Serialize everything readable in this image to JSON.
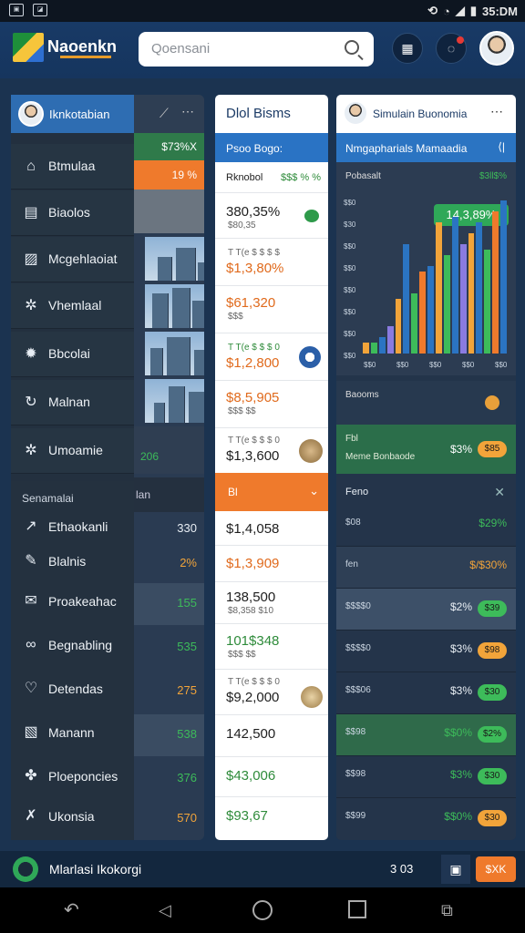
{
  "status": {
    "time": "35:DM",
    "icons": [
      "image-icon",
      "screenshot-icon",
      "sync-icon",
      "wifi-icon",
      "signal-icon",
      "battery-icon"
    ]
  },
  "header": {
    "brand": "Naoenkn",
    "search_placeholder": "Qoensani"
  },
  "drawer": {
    "title": "Iknkotabian",
    "items": [
      {
        "label": "Btmulaa",
        "icon": "home-icon"
      },
      {
        "label": "Biaolos",
        "icon": "document-icon"
      },
      {
        "label": "Mcgehlaoiat",
        "icon": "image-icon"
      },
      {
        "label": "Vhemlaal",
        "icon": "settings-icon"
      },
      {
        "label": "Bbcolai",
        "icon": "gear-icon"
      },
      {
        "label": "Malnan",
        "icon": "refresh-icon"
      },
      {
        "label": "Umoamie",
        "icon": "settings-icon"
      }
    ],
    "section": "Senamalai",
    "items2": [
      {
        "label": "Ethaokanli",
        "icon": "trend-icon"
      },
      {
        "label": "Blalnis",
        "icon": "edit-icon"
      },
      {
        "label": "Proakeahac",
        "icon": "mail-icon"
      },
      {
        "label": "Begnabling",
        "icon": "link-icon"
      },
      {
        "label": "Detendas",
        "icon": "heart-icon"
      },
      {
        "label": "Manann",
        "icon": "chart-icon"
      },
      {
        "label": "Ploeponcies",
        "icon": "puzzle-icon"
      },
      {
        "label": "Ukonsia",
        "icon": "tool-icon"
      }
    ]
  },
  "card1": {
    "row1": "$73%X",
    "row2": "19 %",
    "row3": "206",
    "section": "lan",
    "values": [
      "330",
      "2%",
      "155",
      "535",
      "275",
      "538",
      "376",
      "570"
    ]
  },
  "card2": {
    "title": "Dlol Bisms",
    "blue_label": "Psoo Bogo:",
    "sub_left": "Rknobol",
    "sub_right": "$$$ % %",
    "cells": [
      {
        "main": "380,35%",
        "sub": "$80,35"
      },
      {
        "main": "$1,3,80%",
        "sub": "T T(e $ $ $ $"
      },
      {
        "main": "$61,320",
        "sub": "$$$"
      },
      {
        "main": "$1,2,800",
        "sub": "T T(e $ $ $ 0"
      },
      {
        "main": "$8,5,905",
        "sub": "$$$ $$"
      },
      {
        "main": "$1,3,600",
        "sub": "T T(e $ $ $ 0"
      }
    ],
    "orange_label": "Bl",
    "cells2": [
      {
        "main": "$1,4,058",
        "sub": ""
      },
      {
        "main": "$1,3,909",
        "sub": ""
      },
      {
        "main": "138,500",
        "sub": "$8,358 $10"
      },
      {
        "main": "101$348",
        "sub": "$$$ $$"
      },
      {
        "main": "$9,2,000",
        "sub": "T T(e $ $ $ 0"
      },
      {
        "main": "142,500",
        "sub": ""
      },
      {
        "main": "$43,006",
        "sub": ""
      },
      {
        "main": "$93,67",
        "sub": ""
      }
    ]
  },
  "card3": {
    "title": "Simulain Buonomia",
    "blue_label": "Nmgapharials Mamaadia",
    "chart_header_left": "Pobasalt",
    "chart_header_right": "$3ll$%",
    "badge": "14,3,89%",
    "chart_data": {
      "type": "bar",
      "series": [
        {
          "values": [
            2,
            2,
            3,
            5,
            10,
            20,
            11,
            15,
            16,
            24,
            18,
            25,
            20,
            22,
            24,
            19,
            26,
            28
          ]
        }
      ],
      "y_tick_labels": [
        "$$0",
        "$30",
        "$$0",
        "$$0",
        "$$0",
        "$$0",
        "$$0",
        "$$0"
      ],
      "x_tick_labels": [
        "$$0",
        "$$0",
        "$$0",
        "$$0",
        "$$0"
      ]
    },
    "panel1_title": "Baooms",
    "panel2_line1": "Fbl",
    "panel2_line2": "Meme Bonbaode",
    "panel2_value": "$3%",
    "panel2_pill": "$85",
    "rows_title": "Feno",
    "rows": [
      {
        "key": "$08",
        "value": "$29%",
        "pill": ""
      },
      {
        "key": "fen",
        "value": "$/$30%",
        "pill": ""
      },
      {
        "key": "$$$$0",
        "value": "$2%",
        "pill": "$39"
      },
      {
        "key": "$$$$0",
        "value": "$3%",
        "pill": "$98"
      },
      {
        "key": "$$$06",
        "value": "$3%",
        "pill": "$30"
      },
      {
        "key": "$$98",
        "value": "$$0%",
        "pill": "$2%"
      },
      {
        "key": "$$98",
        "value": "$3%",
        "pill": "$30"
      },
      {
        "key": "$$99",
        "value": "$$0%",
        "pill": "$30"
      }
    ]
  },
  "bottom": {
    "label": "Mlarlasi Ikokorgi",
    "value": "3 03",
    "button": "$XK"
  },
  "colors": {
    "accent": "#2b74c2",
    "orange": "#ef7a2c",
    "green": "#2e8b3a",
    "pill_green": "#3dbb5a",
    "pill_orange": "#f2a43a"
  }
}
